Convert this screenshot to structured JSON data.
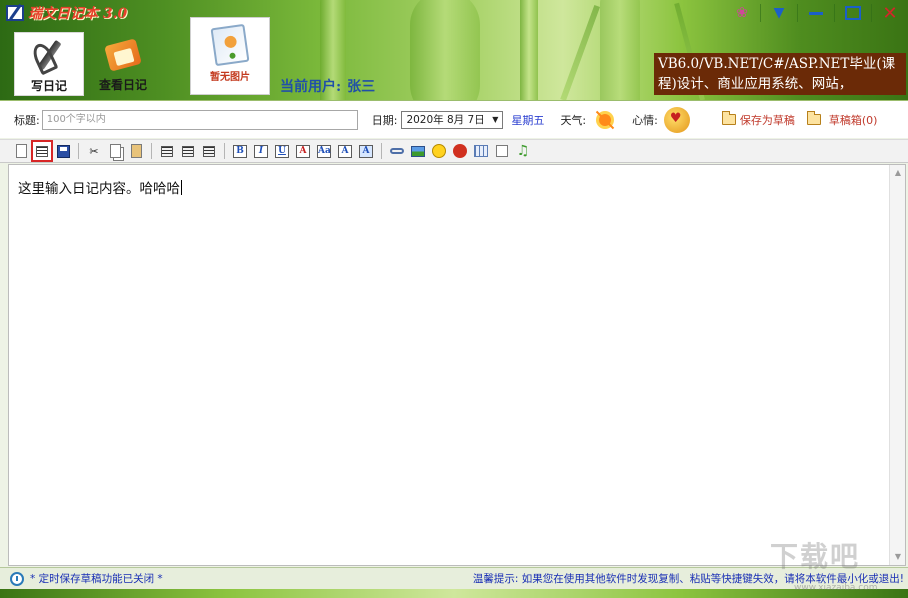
{
  "app": {
    "title": "瑞文日记本 3.0"
  },
  "nav": {
    "write_label": "写日记",
    "view_label": "查看日记"
  },
  "photo": {
    "label": "暂无图片"
  },
  "user": {
    "label": "当前用户:",
    "name": "张三"
  },
  "ad": {
    "line1": "VB6.0/VB.NET/C#/ASP.NET毕业(课",
    "line2": "程)设计、商业应用系统、网站，"
  },
  "form": {
    "title_label": "标题:",
    "title_placeholder": "100个字以内",
    "date_label": "日期:",
    "date_value": "2020年 8月 7日",
    "weekday": "星期五",
    "weather_label": "天气:",
    "mood_label": "心情:",
    "save_draft": "保存为草稿",
    "drafts_box": "草稿箱(0)"
  },
  "editor": {
    "content": "这里输入日记内容。哈哈哈"
  },
  "status": {
    "left": "* 定时保存草稿功能已关闭 *",
    "right": "温馨提示: 如果您在使用其他软件时发现复制、粘贴等快捷键失效，请将本软件最小化或退出!"
  },
  "watermark": {
    "text": "下载吧",
    "sub": "www.xiazaiba.com"
  },
  "colors": {
    "accent": "#1a2fb5",
    "header_green": "#4e8f22",
    "ad_bg": "#6b2a07",
    "title_red": "#e8402b"
  }
}
